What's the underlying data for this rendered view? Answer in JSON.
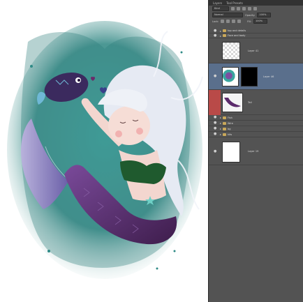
{
  "panel": {
    "tabs": [
      "Layers",
      "Tool Presets"
    ],
    "blend_mode": "Normal",
    "opacity_label": "Opacity:",
    "opacity_value": "100%",
    "lock_label": "Lock:",
    "fill_label": "Fill:",
    "fill_value": "100%",
    "filter_kind": "Kind"
  },
  "layers": [
    {
      "name": "top and details",
      "type": "group"
    },
    {
      "name": "Face and body",
      "type": "group"
    },
    {
      "name": "Layer 41",
      "type": "layer"
    },
    {
      "name": "Layer 46",
      "type": "layer",
      "selected": true
    },
    {
      "name": "Tail",
      "type": "layer"
    },
    {
      "name": "Fish",
      "type": "group"
    },
    {
      "name": "Wire",
      "type": "group"
    },
    {
      "name": "bg",
      "type": "group"
    },
    {
      "name": "kits",
      "type": "group"
    },
    {
      "name": "Layer 19",
      "type": "layer"
    }
  ],
  "colors": {
    "panel_bg": "#535353",
    "selected_layer": "#5a6f8c",
    "teal_wash": "#2f8f8a",
    "tail_purple": "#5b2a6b",
    "hair": "#e8ecf4",
    "top_green": "#1f5a2e",
    "skin": "#f3d6cf"
  }
}
